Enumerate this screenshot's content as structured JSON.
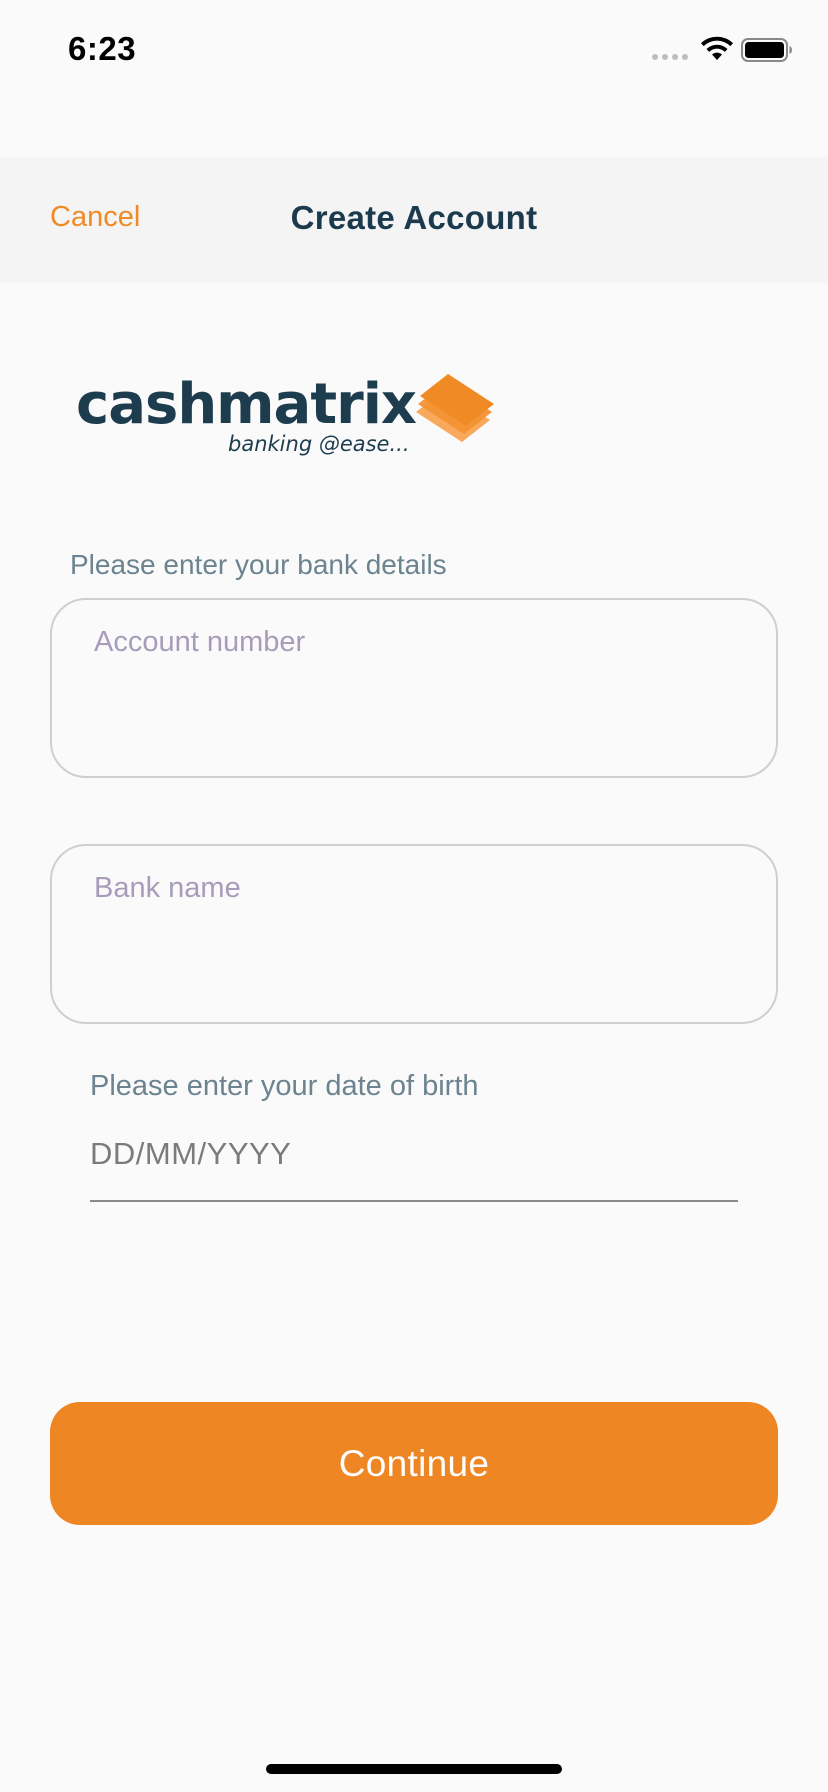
{
  "status_bar": {
    "time": "6:23",
    "icons": [
      "cellular-signal-icon",
      "wifi-icon",
      "battery-icon"
    ]
  },
  "nav": {
    "cancel_label": "Cancel",
    "title": "Create Account"
  },
  "logo": {
    "wordmark": "cashmatrix",
    "tagline": "banking @ease...",
    "brand_color": "#1d3d4f",
    "mark_color": "#f08a24"
  },
  "form": {
    "bank_details_label": "Please enter your bank details",
    "account_number_placeholder": "Account number",
    "account_number_value": "",
    "bank_name_placeholder": "Bank name",
    "bank_name_value": "",
    "dob_label": "Please enter your date of birth",
    "dob_placeholder": "DD/MM/YYYY",
    "dob_value": ""
  },
  "actions": {
    "continue_label": "Continue"
  },
  "colors": {
    "accent": "#ee8623",
    "title": "#1c3a4e",
    "placeholder": "#a79cb9",
    "label": "#6c8390"
  }
}
